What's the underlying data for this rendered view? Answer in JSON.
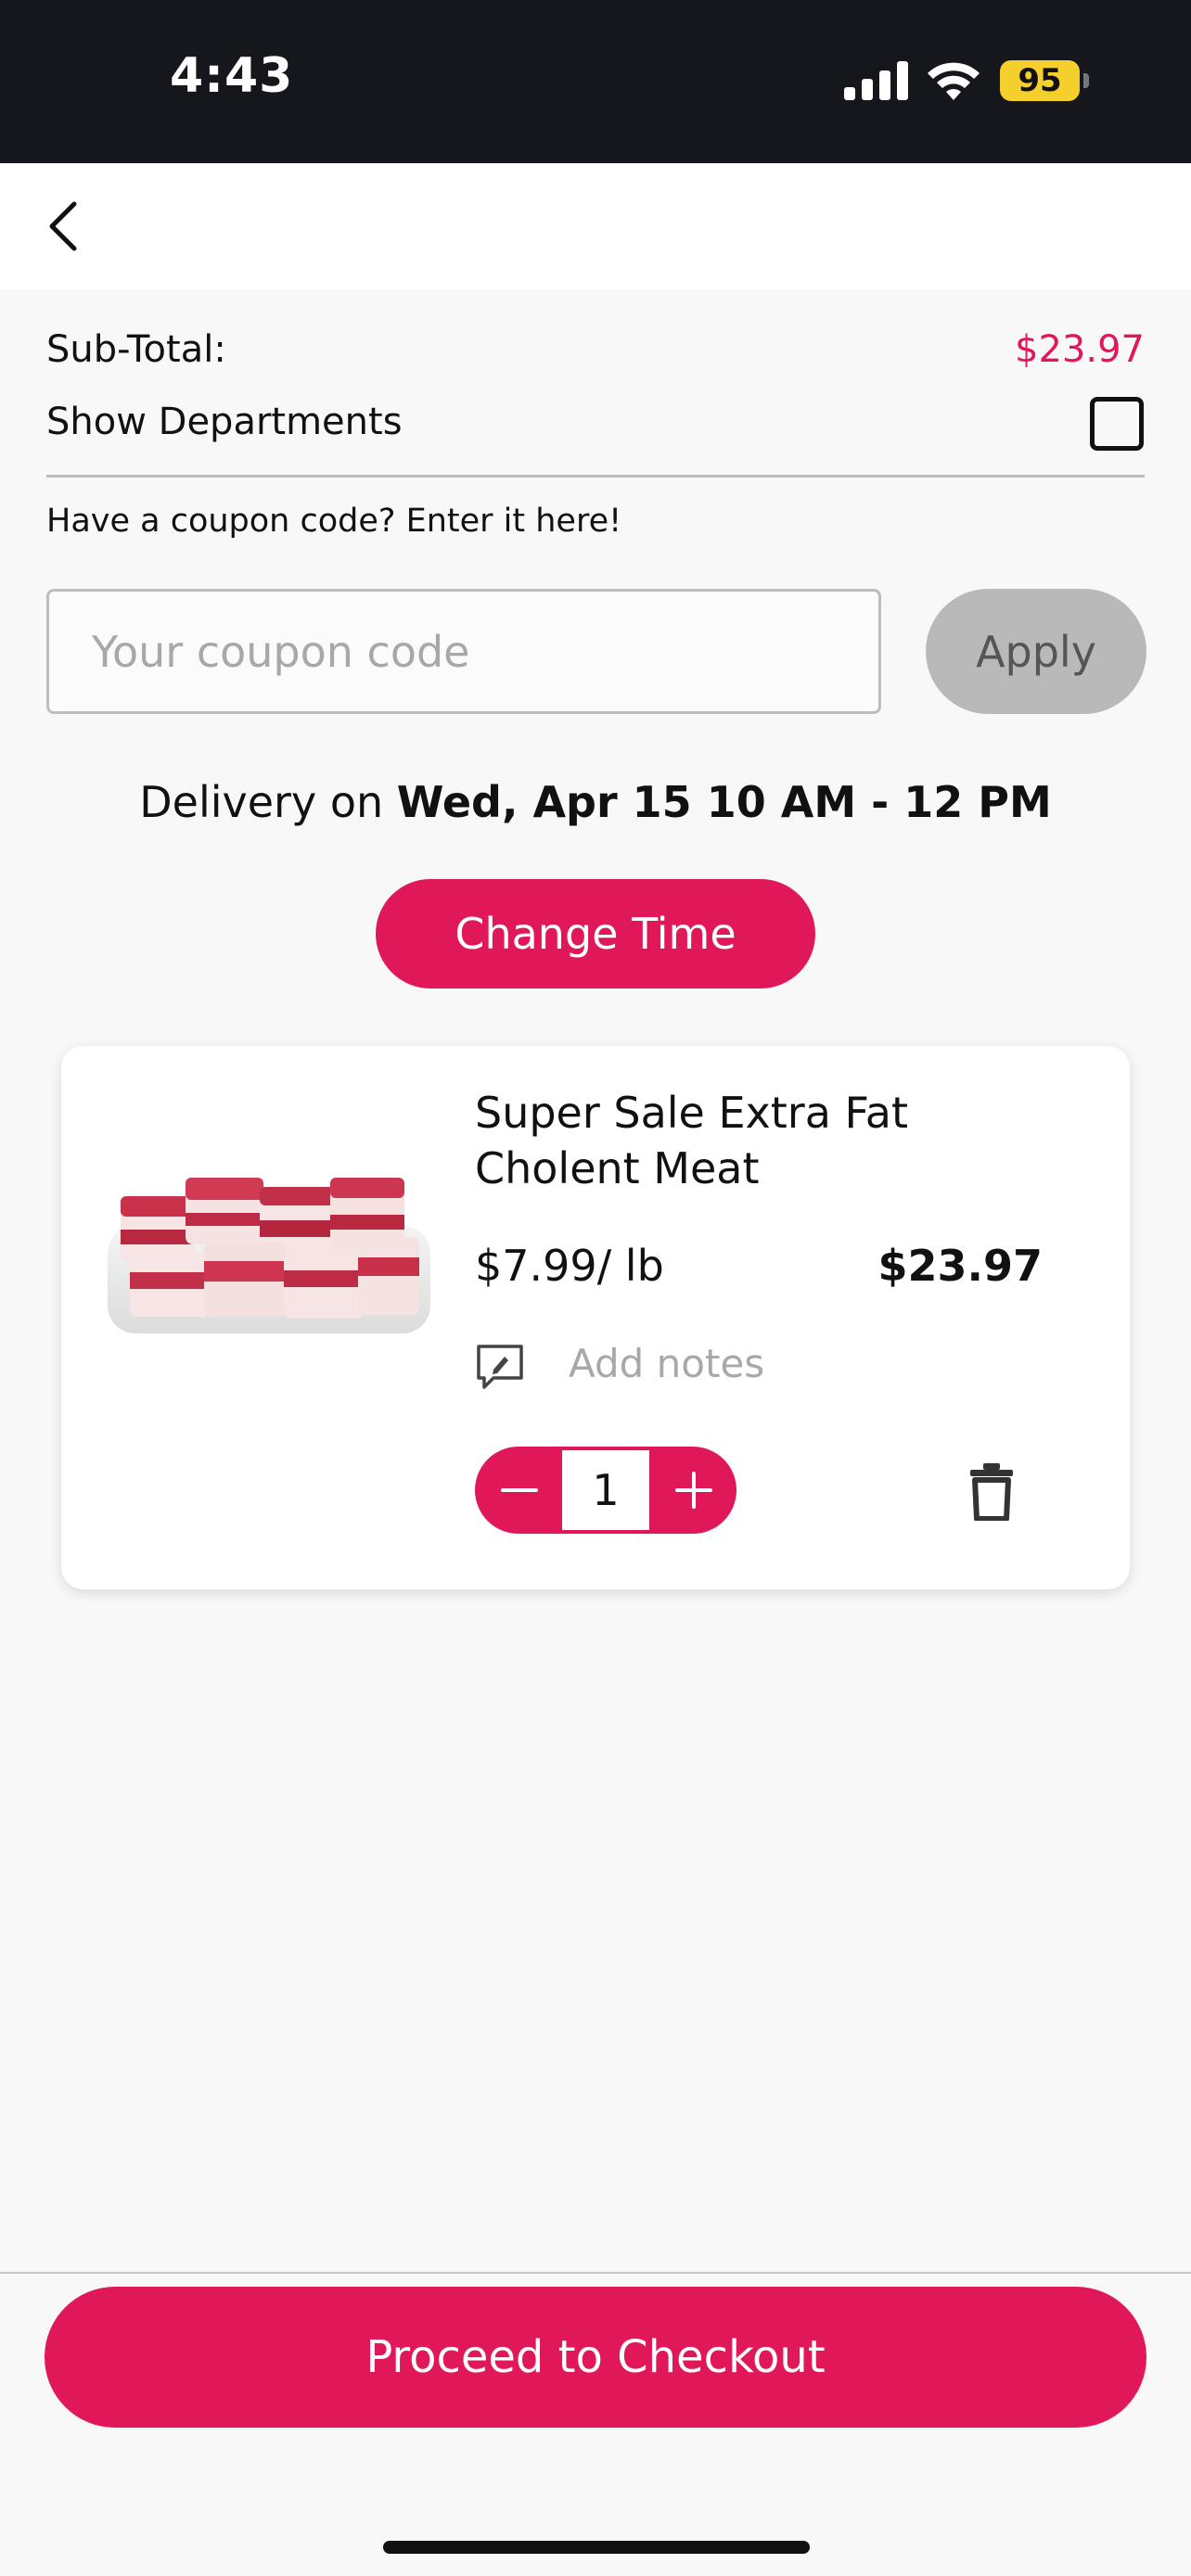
{
  "status_bar": {
    "time": "4:43",
    "battery": "95"
  },
  "cart": {
    "subtotal_label": "Sub-Total:",
    "subtotal_value": "$23.97",
    "show_departments_label": "Show Departments",
    "show_departments_checked": false
  },
  "coupon": {
    "hint": "Have a coupon code? Enter it here!",
    "placeholder": "Your coupon code",
    "value": "",
    "apply_label": "Apply"
  },
  "delivery": {
    "prefix": "Delivery on ",
    "slot": "Wed, Apr 15 10 AM - 12 PM",
    "change_time_label": "Change Time"
  },
  "items": [
    {
      "name": "Super Sale Extra Fat Cholent Meat",
      "unit_price": "$7.99/ lb",
      "total": "$23.97",
      "notes_placeholder": "Add notes",
      "quantity": "1"
    }
  ],
  "checkout": {
    "label": "Proceed to Checkout"
  },
  "colors": {
    "accent": "#e0185a",
    "disabled": "#b9b9b9"
  }
}
